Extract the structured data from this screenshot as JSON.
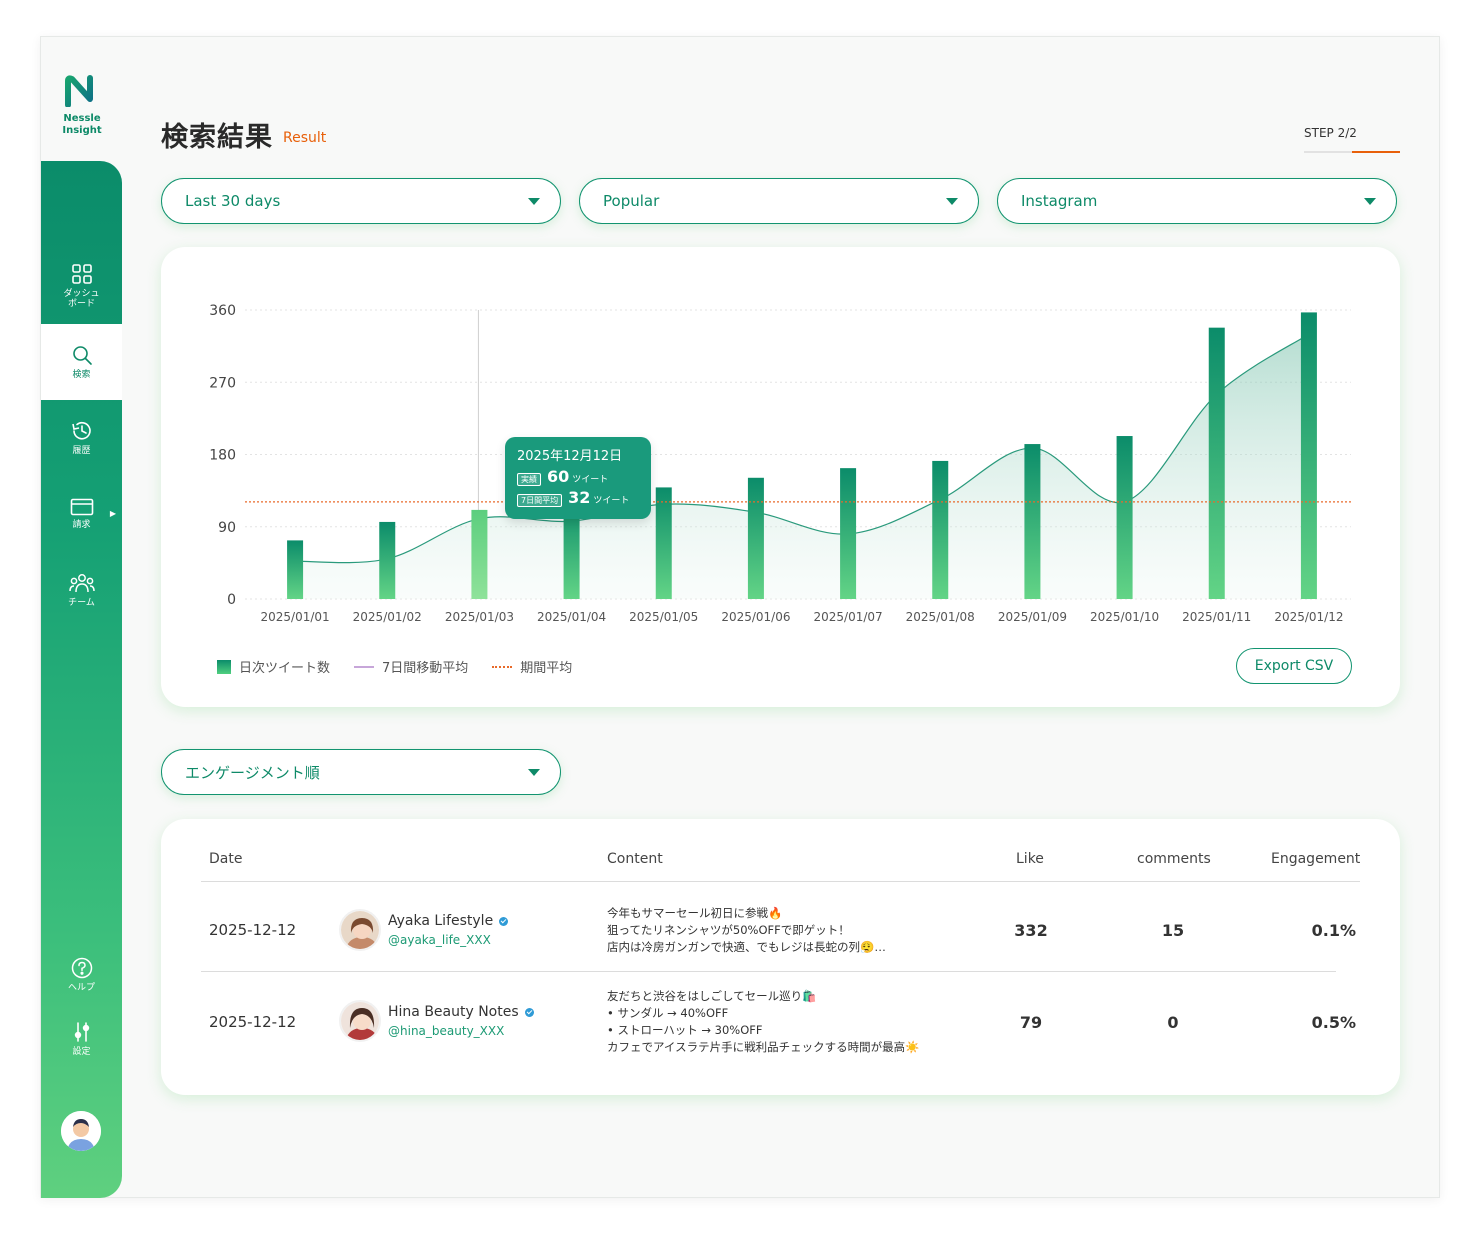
{
  "brand": {
    "name_line1": "Nessle",
    "name_line2": "Insight",
    "color": "#0e8a68"
  },
  "sidebar": {
    "items": [
      {
        "label": "ダッシュ\nボード",
        "icon": "grid-icon"
      },
      {
        "label": "検索",
        "icon": "search-icon",
        "active": true
      },
      {
        "label": "履歴",
        "icon": "history-icon"
      },
      {
        "label": "請求",
        "icon": "card-icon"
      },
      {
        "label": "チーム",
        "icon": "team-icon"
      }
    ],
    "bottom_items": [
      {
        "label": "ヘルプ",
        "icon": "help-icon"
      },
      {
        "label": "設定",
        "icon": "settings-icon"
      }
    ]
  },
  "header": {
    "title": "検索結果",
    "subtitle": "Result",
    "step": "STEP 2/2"
  },
  "filters": {
    "period": "Last 30 days",
    "sort": "Popular",
    "platform": "Instagram"
  },
  "chart_data": {
    "type": "bar",
    "categories": [
      "2025/01/01",
      "2025/01/02",
      "2025/01/03",
      "2025/01/04",
      "2025/01/05",
      "2025/01/06",
      "2025/01/07",
      "2025/01/08",
      "2025/01/09",
      "2025/01/10",
      "2025/01/11",
      "2025/01/12"
    ],
    "series": [
      {
        "name": "日次ツイート数",
        "type": "bar",
        "values": [
          73,
          96,
          111,
          124,
          139,
          151,
          163,
          172,
          193,
          203,
          338,
          357
        ]
      },
      {
        "name": "7日間移動平均",
        "type": "area",
        "values": [
          47,
          50,
          100,
          97,
          118,
          108,
          81,
          124,
          188,
          121,
          255,
          330
        ]
      },
      {
        "name": "期間平均",
        "type": "line",
        "values": [
          121
        ]
      }
    ],
    "yticks": [
      0,
      90,
      180,
      270,
      360
    ],
    "ylim": [
      0,
      360
    ],
    "highlight_index": 2,
    "grid": true,
    "legend_position": "bottom-left",
    "colors": {
      "bar_top": "#0b8c6a",
      "bar_bottom": "#63d486",
      "area": "#8cc9b5",
      "avg_line": "#e86a2a"
    }
  },
  "tooltip": {
    "title": "2025年12月12日",
    "actual_label": "実績",
    "actual_value": "60",
    "actual_unit": "ツイート",
    "avg_label": "7日間平均",
    "avg_value": "32",
    "avg_unit": "ツイート"
  },
  "legend": {
    "bar": "日次ツイート数",
    "moving_avg": "7日間移動平均",
    "period_avg": "期間平均"
  },
  "export_label": "Export CSV",
  "sort_select": "エンゲージメント順",
  "table": {
    "headers": {
      "date": "Date",
      "content": "Content",
      "like": "Like",
      "comments": "comments",
      "engagement": "Engagement"
    },
    "rows": [
      {
        "date": "2025-12-12",
        "name": "Ayaka Lifestyle",
        "handle": "@ayaka_life_XXX",
        "content": "今年もサマーセール初日に参戦🔥\n狙ってたリネンシャツが50%OFFで即ゲット！\n店内は冷房ガンガンで快適、でもレジは長蛇の列😮‍💨…",
        "like": "332",
        "comments": "15",
        "engagement": "0.1%"
      },
      {
        "date": "2025-12-12",
        "name": "Hina Beauty Notes",
        "handle": "@hina_beauty_XXX",
        "content": "友だちと渋谷をはしごしてセール巡り🛍️\n • サンダル → 40%OFF\n • ストローハット → 30%OFF\nカフェでアイスラテ片手に戦利品チェックする時間が最高☀️",
        "like": "79",
        "comments": "0",
        "engagement": "0.5%"
      }
    ]
  }
}
